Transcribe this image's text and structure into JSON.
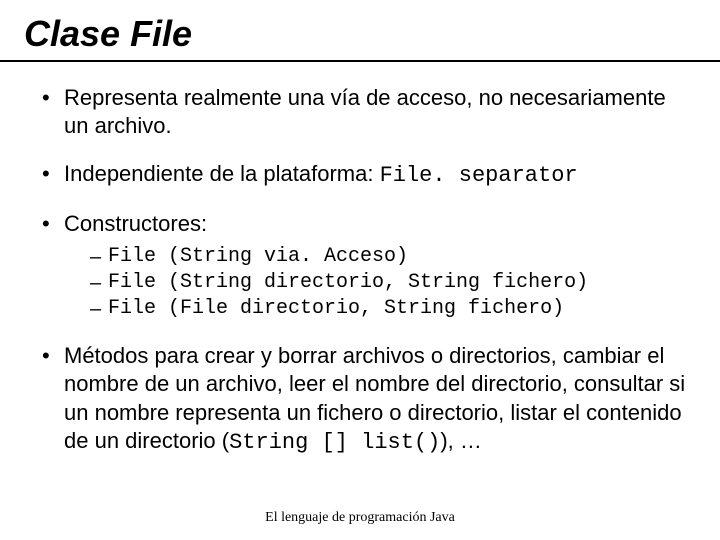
{
  "title": "Clase File",
  "bullets": {
    "b1": "Representa realmente una vía de acceso, no necesariamente un archivo.",
    "b2_pre": "Independiente de la plataforma: ",
    "b2_code": "File. separator",
    "b3": "Constructores:",
    "constructors": {
      "c1": "File (String via. Acceso)",
      "c2": "File (String directorio, String fichero)",
      "c3": "File (File directorio, String fichero)"
    },
    "b4_pre": "Métodos para crear y borrar archivos o directorios, cambiar el nombre de un archivo, leer el nombre del directorio, consultar si un nombre representa un fichero o directorio, listar el contenido de un directorio (",
    "b4_code": "String [] list()",
    "b4_post": "), …"
  },
  "footer": "El lenguaje de programación Java"
}
